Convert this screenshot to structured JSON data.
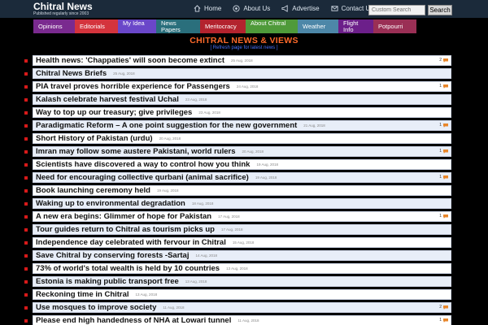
{
  "brand": {
    "title": "Chitral News",
    "tagline": "Published regularly since 2003"
  },
  "topnav": [
    {
      "label": "Home",
      "icon": "home-icon"
    },
    {
      "label": "About Us",
      "icon": "about-icon"
    },
    {
      "label": "Advertise",
      "icon": "advertise-icon"
    },
    {
      "label": "Contact Us",
      "icon": "envelope-icon"
    }
  ],
  "search": {
    "placeholder": "Custom Search",
    "button": "Search"
  },
  "categories": [
    {
      "label": "Opinions",
      "color": "#7a2a8f"
    },
    {
      "label": "Editorials",
      "color": "#d4343d"
    },
    {
      "label": "My Idea",
      "color": "#6a47c9"
    },
    {
      "label": "News Papers",
      "color": "#2a6f7c"
    },
    {
      "label": "Meritocracy",
      "color": "#b3232e"
    },
    {
      "label": "About Chitral",
      "color": "#4f9a3a"
    },
    {
      "label": "Weather",
      "color": "#4d87a8"
    },
    {
      "label": "Flight Info",
      "color": "#6c1f8a"
    },
    {
      "label": "Potpourri",
      "color": "#9a2f55"
    }
  ],
  "page": {
    "heading": "CHITRAL NEWS & VIEWS",
    "subheading": "[ Refresh page for latest news ]"
  },
  "articles": [
    {
      "title": "Health news: 'Chappaties' will soon become extinct",
      "date": "25 Aug, 2018",
      "comments": "2"
    },
    {
      "title": "Chitral News Briefs",
      "date": "25 Aug, 2018",
      "comments": ""
    },
    {
      "title": "PIA travel proves horrible experience for Passengers",
      "date": "24 Aug, 2018",
      "comments": "1"
    },
    {
      "title": "Kalash celebrate harvest festival Uchal",
      "date": "23 Aug, 2018",
      "comments": ""
    },
    {
      "title": "Way to top up our treasury; give privileges",
      "date": "23 Aug, 2018",
      "comments": ""
    },
    {
      "title": "Paradigmatic Reform – A one point suggestion for the new government",
      "date": "21 Aug, 2018",
      "comments": "1"
    },
    {
      "title": "Short History of Pakistan (urdu)",
      "date": "20 Aug, 2018",
      "comments": ""
    },
    {
      "title": "Imran may follow some austere Pakistani, world rulers",
      "date": "20 Aug, 2018",
      "comments": "1"
    },
    {
      "title": "Scientists have discovered a way to control how you think",
      "date": "19 Aug, 2018",
      "comments": ""
    },
    {
      "title": "Need for encouraging collective qurbani (animal sacrifice)",
      "date": "19 Aug, 2018",
      "comments": "1"
    },
    {
      "title": "Book launching ceremony held",
      "date": "19 Aug, 2018",
      "comments": ""
    },
    {
      "title": "Waking up to environmental degradation",
      "date": "18 Aug, 2018",
      "comments": ""
    },
    {
      "title": "A new era begins: Glimmer of hope for Pakistan",
      "date": "17 Aug, 2018",
      "comments": "1"
    },
    {
      "title": "Tour guides return to Chitral as tourism picks up",
      "date": "17 Aug, 2018",
      "comments": ""
    },
    {
      "title": "Independence day celebrated with fervour in Chitral",
      "date": "15 Aug, 2018",
      "comments": ""
    },
    {
      "title": "Save Chitral by conserving forests -Sartaj",
      "date": "14 Aug, 2018",
      "comments": ""
    },
    {
      "title": "73% of world's total wealth is held by 10 countries",
      "date": "13 Aug, 2018",
      "comments": ""
    },
    {
      "title": "Estonia is making public transport free",
      "date": "13 Aug, 2018",
      "comments": ""
    },
    {
      "title": "Reckoning time in Chitral",
      "date": "13 Aug, 2018",
      "comments": ""
    },
    {
      "title": "Use mosques to improve society",
      "date": "11 Aug, 2018",
      "comments": "2"
    },
    {
      "title": "Please end high handedness of NHA at Lowari tunnel",
      "date": "11 Aug, 2018",
      "comments": "1"
    }
  ]
}
